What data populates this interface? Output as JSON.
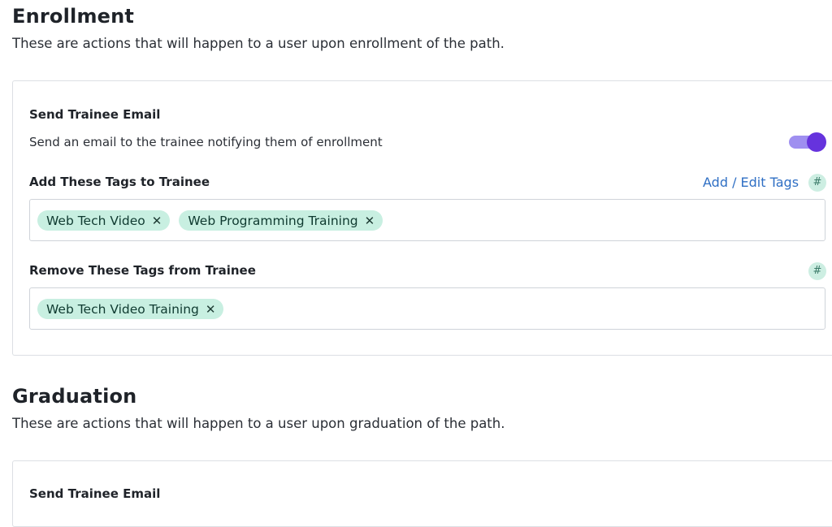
{
  "enrollment": {
    "title": "Enrollment",
    "description": "These are actions that will happen to a user upon enrollment of the path.",
    "send_email": {
      "label": "Send Trainee Email",
      "description": "Send an email to the trainee notifying them of enrollment",
      "enabled": true
    },
    "add_tags": {
      "label": "Add These Tags to Trainee",
      "link": "Add / Edit Tags",
      "icon": "hash-icon",
      "tags": [
        "Web Tech Video",
        "Web Programming Training"
      ]
    },
    "remove_tags": {
      "label": "Remove These Tags from Trainee",
      "icon": "hash-icon",
      "tags": [
        "Web Tech Video Training"
      ]
    }
  },
  "graduation": {
    "title": "Graduation",
    "description": "These are actions that will happen to a user upon graduation of the path.",
    "send_email": {
      "label": "Send Trainee Email"
    }
  },
  "icons": {
    "hash_glyph": "#",
    "remove_glyph": "✕"
  },
  "colors": {
    "toggle_on": "#6633dd",
    "toggle_track": "#9f8ff0",
    "tag_bg": "#c8efe1",
    "link": "#2f6fc4"
  }
}
